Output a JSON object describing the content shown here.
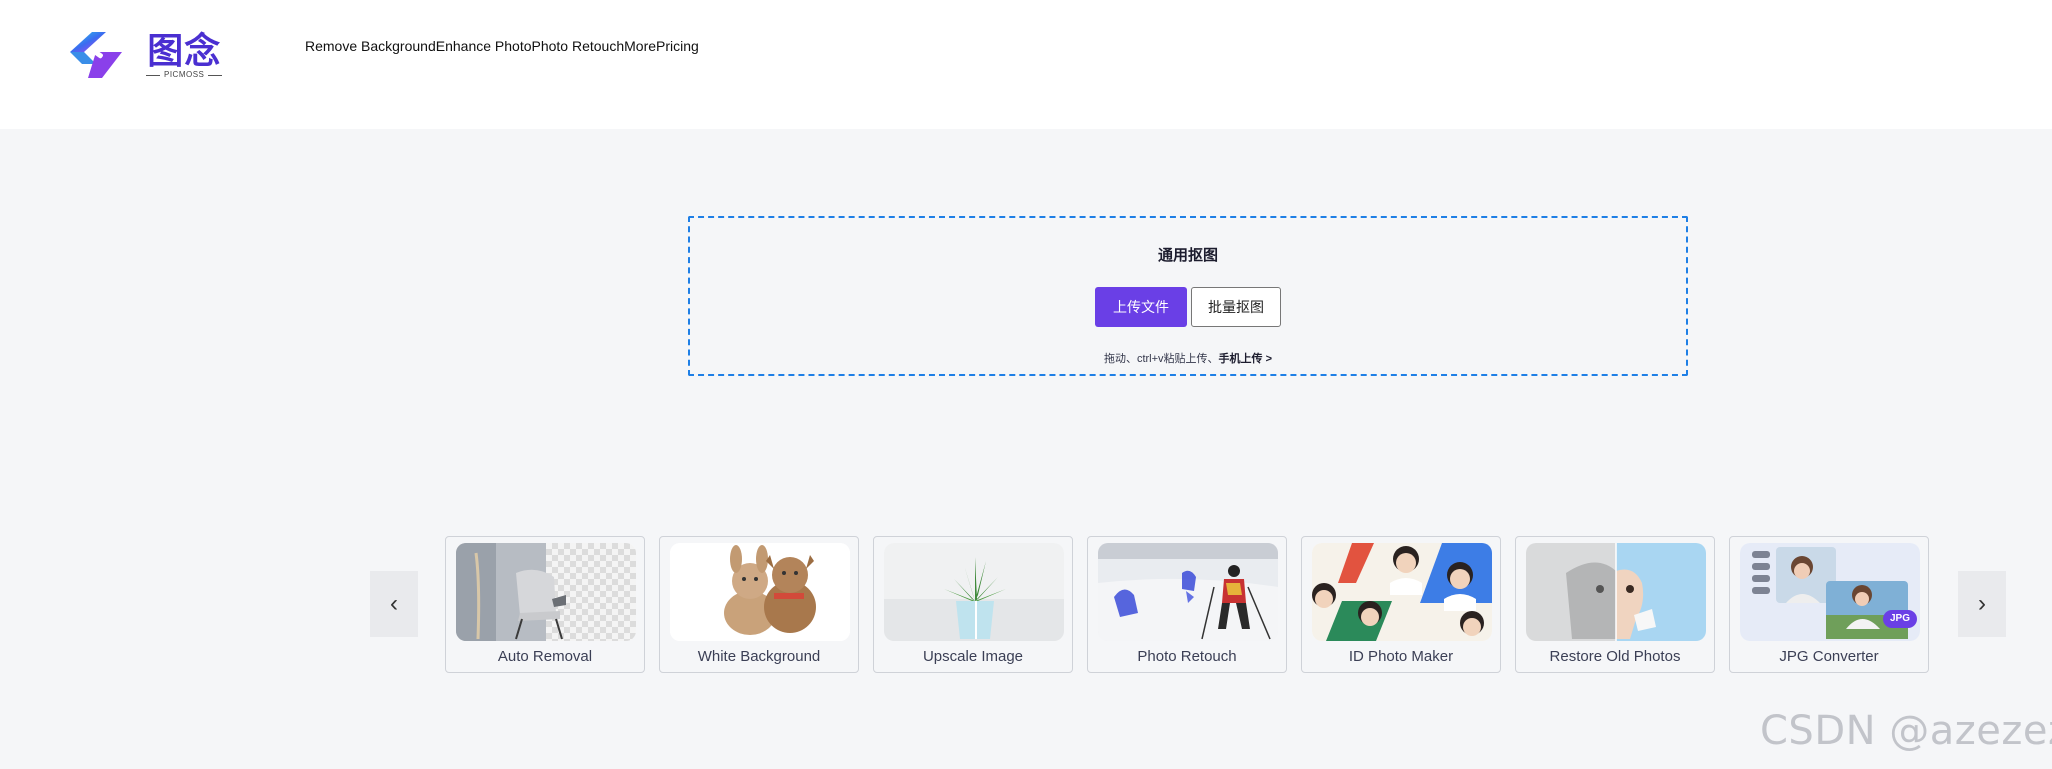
{
  "header": {
    "logo": {
      "cn": "图念",
      "en": "PICMOSS"
    },
    "nav": [
      "Remove Background",
      "Enhance Photo",
      "Photo Retouch",
      "More",
      "Pricing"
    ]
  },
  "upload": {
    "title": "通用抠图",
    "upload_button": "上传文件",
    "batch_button": "批量抠图",
    "hint_text": "拖动、ctrl+v粘贴上传、",
    "hint_link": "手机上传 >"
  },
  "carousel": {
    "prev_icon": "‹",
    "next_icon": "›",
    "tools": [
      "Auto Removal",
      "White Background",
      "Upscale Image",
      "Photo Retouch",
      "ID Photo Maker",
      "Restore Old Photos",
      "JPG Converter"
    ],
    "jpg_badge": "JPG"
  },
  "watermark": "CSDN @azezeze",
  "colors": {
    "brand": "#4a2fd1",
    "primary_button": "#6a3fe6",
    "dashed_border": "#1e7fe6"
  }
}
